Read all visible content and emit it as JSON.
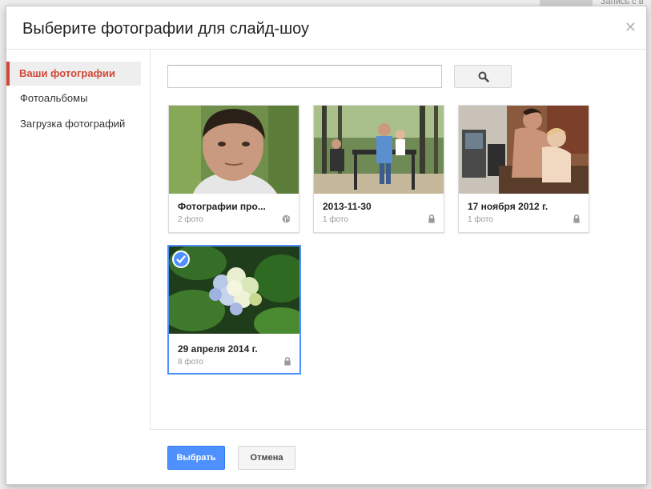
{
  "dialog": {
    "title": "Выберите фотографии для слайд-шоу",
    "close_icon": "close-icon"
  },
  "sidebar": {
    "items": [
      {
        "label": "Ваши фотографии",
        "active": true
      },
      {
        "label": "Фотоальбомы",
        "active": false
      },
      {
        "label": "Загрузка фотографий",
        "active": false
      }
    ]
  },
  "search": {
    "value": "",
    "placeholder": "",
    "button_icon": "search-icon"
  },
  "albums": [
    {
      "title": "Фотографии про...",
      "count": "2 фото",
      "visibility_icon": "globe-icon",
      "selected": false
    },
    {
      "title": "2013-11-30",
      "count": "1 фото",
      "visibility_icon": "lock-icon",
      "selected": false
    },
    {
      "title": "17 ноября 2012 г.",
      "count": "1 фото",
      "visibility_icon": "lock-icon",
      "selected": false
    },
    {
      "title": "29 апреля 2014 г.",
      "count": "8 фото",
      "visibility_icon": "lock-icon",
      "selected": true
    }
  ],
  "footer": {
    "select_label": "Выбрать",
    "cancel_label": "Отмена"
  },
  "background": {
    "top_right_text": "Запись с в"
  },
  "colors": {
    "accent_red": "#d14836",
    "primary_blue": "#4d90fe"
  }
}
